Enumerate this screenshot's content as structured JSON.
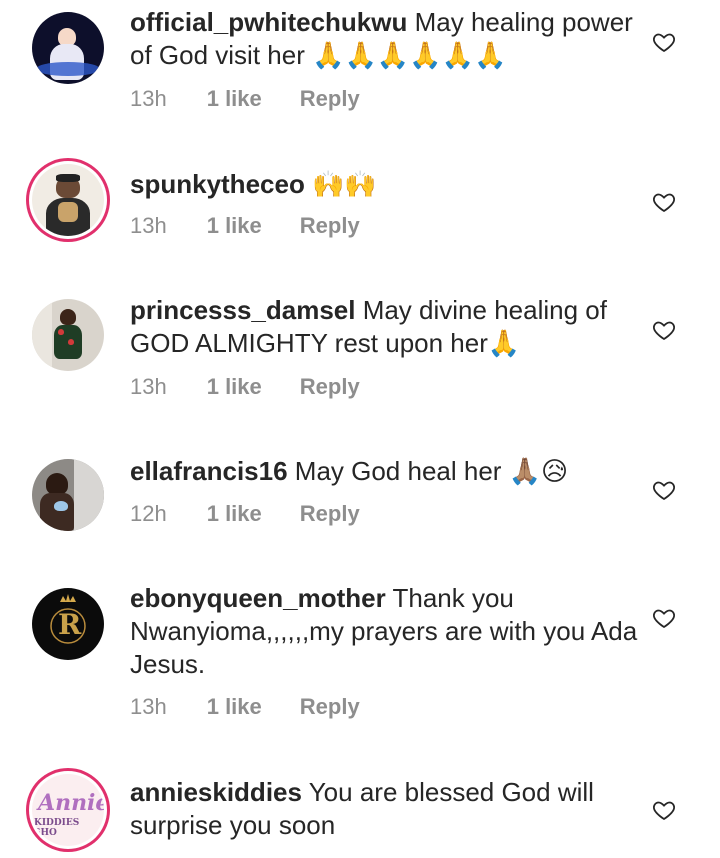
{
  "comments": [
    {
      "username": "official_pwhitechukwu",
      "text": " May healing power of God visit her 🙏🙏🙏🙏🙏🙏",
      "time": "13h",
      "likes": "1 like",
      "reply": "Reply"
    },
    {
      "username": "spunkytheceo",
      "text": " 🙌🙌",
      "time": "13h",
      "likes": "1 like",
      "reply": "Reply"
    },
    {
      "username": "princesss_damsel",
      "text": " May divine healing of GOD ALMIGHTY rest upon her🙏",
      "time": "13h",
      "likes": "1 like",
      "reply": "Reply"
    },
    {
      "username": "ellafrancis16",
      "text": " May God heal her 🙏🏽😥",
      "time": "12h",
      "likes": "1 like",
      "reply": "Reply"
    },
    {
      "username": "ebonyqueen_mother",
      "text": " Thank you Nwanyioma,,,,,,my prayers are with you Ada Jesus.",
      "time": "13h",
      "likes": "1 like",
      "reply": "Reply"
    },
    {
      "username": "annieskiddies",
      "text": " You are blessed God will surprise you soon",
      "time": "",
      "likes": "",
      "reply": ""
    }
  ],
  "avatar_logo": {
    "ebony_letter": "R",
    "annie_word": "Annie",
    "annie_sub": "KIDDIES SHO"
  },
  "colors": {
    "text": "#262626",
    "meta": "#8e8e8e",
    "story_ring": "#e1306c"
  }
}
